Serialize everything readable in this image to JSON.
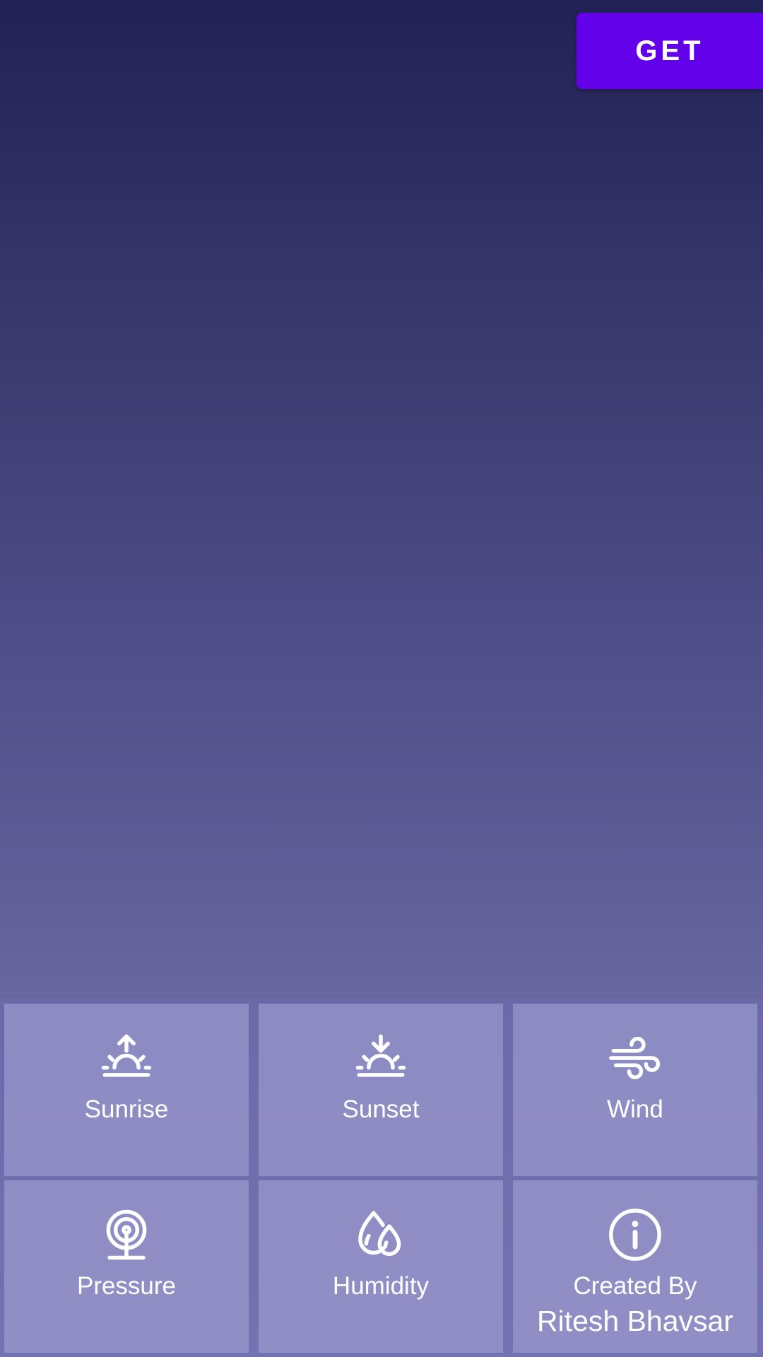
{
  "header": {
    "get_button_label": "GET"
  },
  "tiles": [
    {
      "label": "Sunrise",
      "icon": "sunrise-icon"
    },
    {
      "label": "Sunset",
      "icon": "sunset-icon"
    },
    {
      "label": "Wind",
      "icon": "wind-icon"
    },
    {
      "label": "Pressure",
      "icon": "pressure-icon"
    },
    {
      "label": "Humidity",
      "icon": "humidity-icon"
    },
    {
      "label": "Created By",
      "sublabel": "Ritesh Bhavsar",
      "icon": "info-icon"
    }
  ],
  "colors": {
    "accent": "#6200ea",
    "background_top": "#222156",
    "background_bottom": "#7d7cb3",
    "tile": "#9a98cb",
    "text": "#ffffff"
  }
}
